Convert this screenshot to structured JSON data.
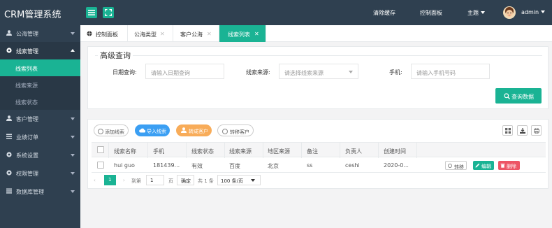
{
  "app": {
    "title": "CRM管理系统"
  },
  "topbar": {
    "clear_cache": "清除缓存",
    "control_panel": "控制面板",
    "theme": "主题",
    "user": "admin"
  },
  "sidebar": {
    "items": [
      {
        "label": "公海管理",
        "icon": "user-icon"
      },
      {
        "label": "线索管理",
        "icon": "gear-icon"
      },
      {
        "label": "客户管理",
        "icon": "user-icon"
      },
      {
        "label": "业绩订单",
        "icon": "list-icon"
      },
      {
        "label": "系统设置",
        "icon": "gear-icon"
      },
      {
        "label": "权限管理",
        "icon": "gear-icon"
      },
      {
        "label": "数据库管理",
        "icon": "list-icon"
      }
    ],
    "subitems": [
      {
        "label": "线索列表"
      },
      {
        "label": "线索来源"
      },
      {
        "label": "线索状态"
      }
    ]
  },
  "tabs": [
    {
      "label": "控制面板"
    },
    {
      "label": "公海类型"
    },
    {
      "label": "客户公海"
    },
    {
      "label": "线索列表"
    }
  ],
  "search": {
    "legend": "高级查询",
    "date_label": "日期查询:",
    "date_placeholder": "请输入日期查询",
    "source_label": "线索来源:",
    "source_placeholder": "请选择线索来源",
    "phone_label": "手机:",
    "phone_placeholder": "请输入手机号码",
    "query_button": "查询数据"
  },
  "toolbar": {
    "add": "添加线索",
    "import": "导入线索",
    "convert": "转成客户",
    "transfer": "转移客户"
  },
  "colors": {
    "accent": "#1ab394",
    "nav": "#2f4050",
    "import": "#3b9ff3",
    "convert": "#f8ac59",
    "delete": "#ed5565"
  },
  "table": {
    "columns": [
      "线索名称",
      "手机",
      "线索状态",
      "线索来源",
      "地区来源",
      "备注",
      "负责人",
      "创建时间"
    ],
    "rows": [
      {
        "cells": [
          "hui guo",
          "181439...",
          "有效",
          "百度",
          "北京",
          "ss",
          "ceshi",
          "2020-0..."
        ],
        "actions": {
          "transfer": "转移",
          "edit": "编辑",
          "delete": "删除"
        }
      }
    ]
  },
  "pager": {
    "current": "1",
    "goto_label": "到第",
    "page_value": "1",
    "page_unit": "页",
    "confirm": "确定",
    "total": "共 1 条",
    "page_size": "100 条/页"
  }
}
